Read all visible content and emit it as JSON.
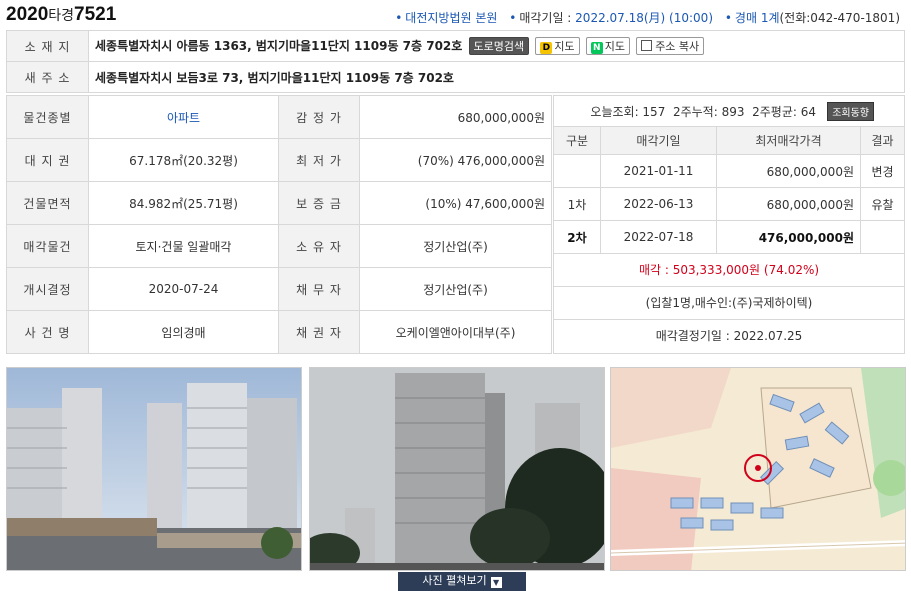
{
  "header": {
    "case_year": "2020",
    "case_type": "타경",
    "case_num": "7521",
    "court": "대전지방법원 본원",
    "sale_date_label": "매각기일 : ",
    "sale_date": "2022.07.18(月) (10:00)",
    "dept": "경매 1계",
    "phone": "(전화:042-470-1801)"
  },
  "address": {
    "loc_label": "소 재 지",
    "loc_value": "세종특별자치시 아름동 1363, 범지기마을11단지 1109동 7층 702호",
    "road_btn": "도로명검색",
    "kakao_btn": "지도",
    "naver_btn": "지도",
    "copy_btn": "주소 복사",
    "new_label": "새 주 소",
    "new_value": "세종특별자치시 보듬3로 73, 범지기마을11단지 1109동 7층 702호"
  },
  "info": [
    {
      "l1": "물건종별",
      "v1": "아파트",
      "l2": "감 정 가",
      "v2": "680,000,000원"
    },
    {
      "l1": "대 지 권",
      "v1": "67.178㎡(20.32평)",
      "l2": "최 저 가",
      "v2": "(70%) 476,000,000원"
    },
    {
      "l1": "건물면적",
      "v1": "84.982㎡(25.71평)",
      "l2": "보 증 금",
      "v2": "(10%) 47,600,000원"
    },
    {
      "l1": "매각물건",
      "v1": "토지·건물 일괄매각",
      "l2": "소 유 자",
      "v2": "정기산업(주)"
    },
    {
      "l1": "개시결정",
      "v1": "2020-07-24",
      "l2": "채 무 자",
      "v2": "정기산업(주)"
    },
    {
      "l1": "사 건 명",
      "v1": "임의경매",
      "l2": "채 권 자",
      "v2": "오케이엘앤아이대부(주)"
    }
  ],
  "stats": {
    "text": "오늘조회: 157  2주누적: 893  2주평균: 64",
    "trend_btn": "조회동향"
  },
  "history": {
    "headers": [
      "구분",
      "매각기일",
      "최저매각가격",
      "결과"
    ],
    "rows": [
      {
        "round": "",
        "date": "2021-01-11",
        "price": "680,000,000원",
        "result": "변경"
      },
      {
        "round": "1차",
        "date": "2022-06-13",
        "price": "680,000,000원",
        "result": "유찰"
      },
      {
        "round": "2차",
        "date": "2022-07-18",
        "price": "476,000,000원",
        "result": ""
      }
    ]
  },
  "sale": {
    "label": "매각 : ",
    "amount": "503,333,000원",
    "pct": "(74.02%)"
  },
  "bidder": "(입찰1명,매수인:(주)국제하이텍)",
  "decision": "매각결정기일 : 2022.07.25",
  "photo_button": "사진 펼쳐보기",
  "colors": {
    "accent": "#1c58b3",
    "sale_red": "#d0021b",
    "button_navy": "#2d3d57"
  }
}
